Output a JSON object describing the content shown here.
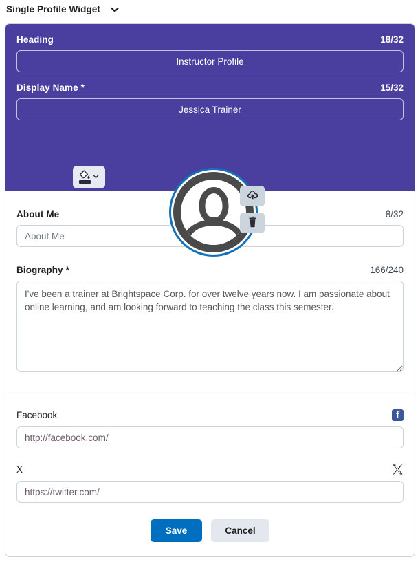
{
  "widget_bar": {
    "title": "Single Profile Widget",
    "chevron_icon": "chevron-down-icon"
  },
  "banner": {
    "background_color": "#4a3e9e",
    "heading": {
      "label": "Heading",
      "count": "18/32",
      "value": "Instructor Profile"
    },
    "display_name": {
      "label": "Display Name *",
      "count": "15/32",
      "value": "Jessica Trainer"
    },
    "color_picker": {
      "icon": "paint-bucket-icon",
      "chevron_icon": "chevron-down-icon",
      "swatch_color": "#2b2b38"
    },
    "avatar": {
      "icon": "user-avatar-placeholder-icon",
      "ring_color": "#1470b8",
      "upload_icon": "cloud-upload-icon",
      "delete_icon": "trash-icon"
    }
  },
  "about": {
    "label": "About Me",
    "count": "8/32",
    "value": "",
    "placeholder": "About Me"
  },
  "biography": {
    "label": "Biography *",
    "count": "166/240",
    "value": "I've been a trainer at Brightspace Corp. for over twelve years now. I am passionate about online learning, and am looking forward to teaching the class this semester."
  },
  "social": {
    "facebook": {
      "label": "Facebook",
      "icon": "facebook-icon",
      "icon_color": "#3b5998",
      "glyph": "f",
      "value": "http://facebook.com/"
    },
    "x": {
      "label": "X",
      "icon": "x-twitter-icon",
      "value": "https://twitter.com/"
    }
  },
  "actions": {
    "save_label": "Save",
    "save_color": "#006fbf",
    "cancel_label": "Cancel"
  }
}
